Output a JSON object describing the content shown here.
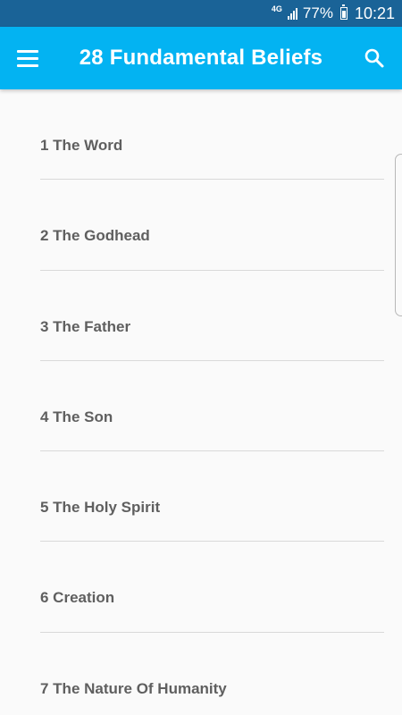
{
  "status_bar": {
    "network": "4G",
    "battery_percent": "77%",
    "time": "10:21",
    "icons": [
      "network-4g-icon",
      "signal-icon",
      "battery-icon"
    ]
  },
  "app_bar": {
    "title": "28 Fundamental Beliefs",
    "menu_icon": "hamburger-menu-icon",
    "search_icon": "search-icon",
    "background_color": "#03b3f2"
  },
  "beliefs": [
    {
      "label": "1 The Word"
    },
    {
      "label": "2 The Godhead"
    },
    {
      "label": "3 The Father"
    },
    {
      "label": "4 The Son"
    },
    {
      "label": "5 The Holy Spirit"
    },
    {
      "label": "6 Creation"
    },
    {
      "label": "7 The Nature Of Humanity"
    }
  ]
}
